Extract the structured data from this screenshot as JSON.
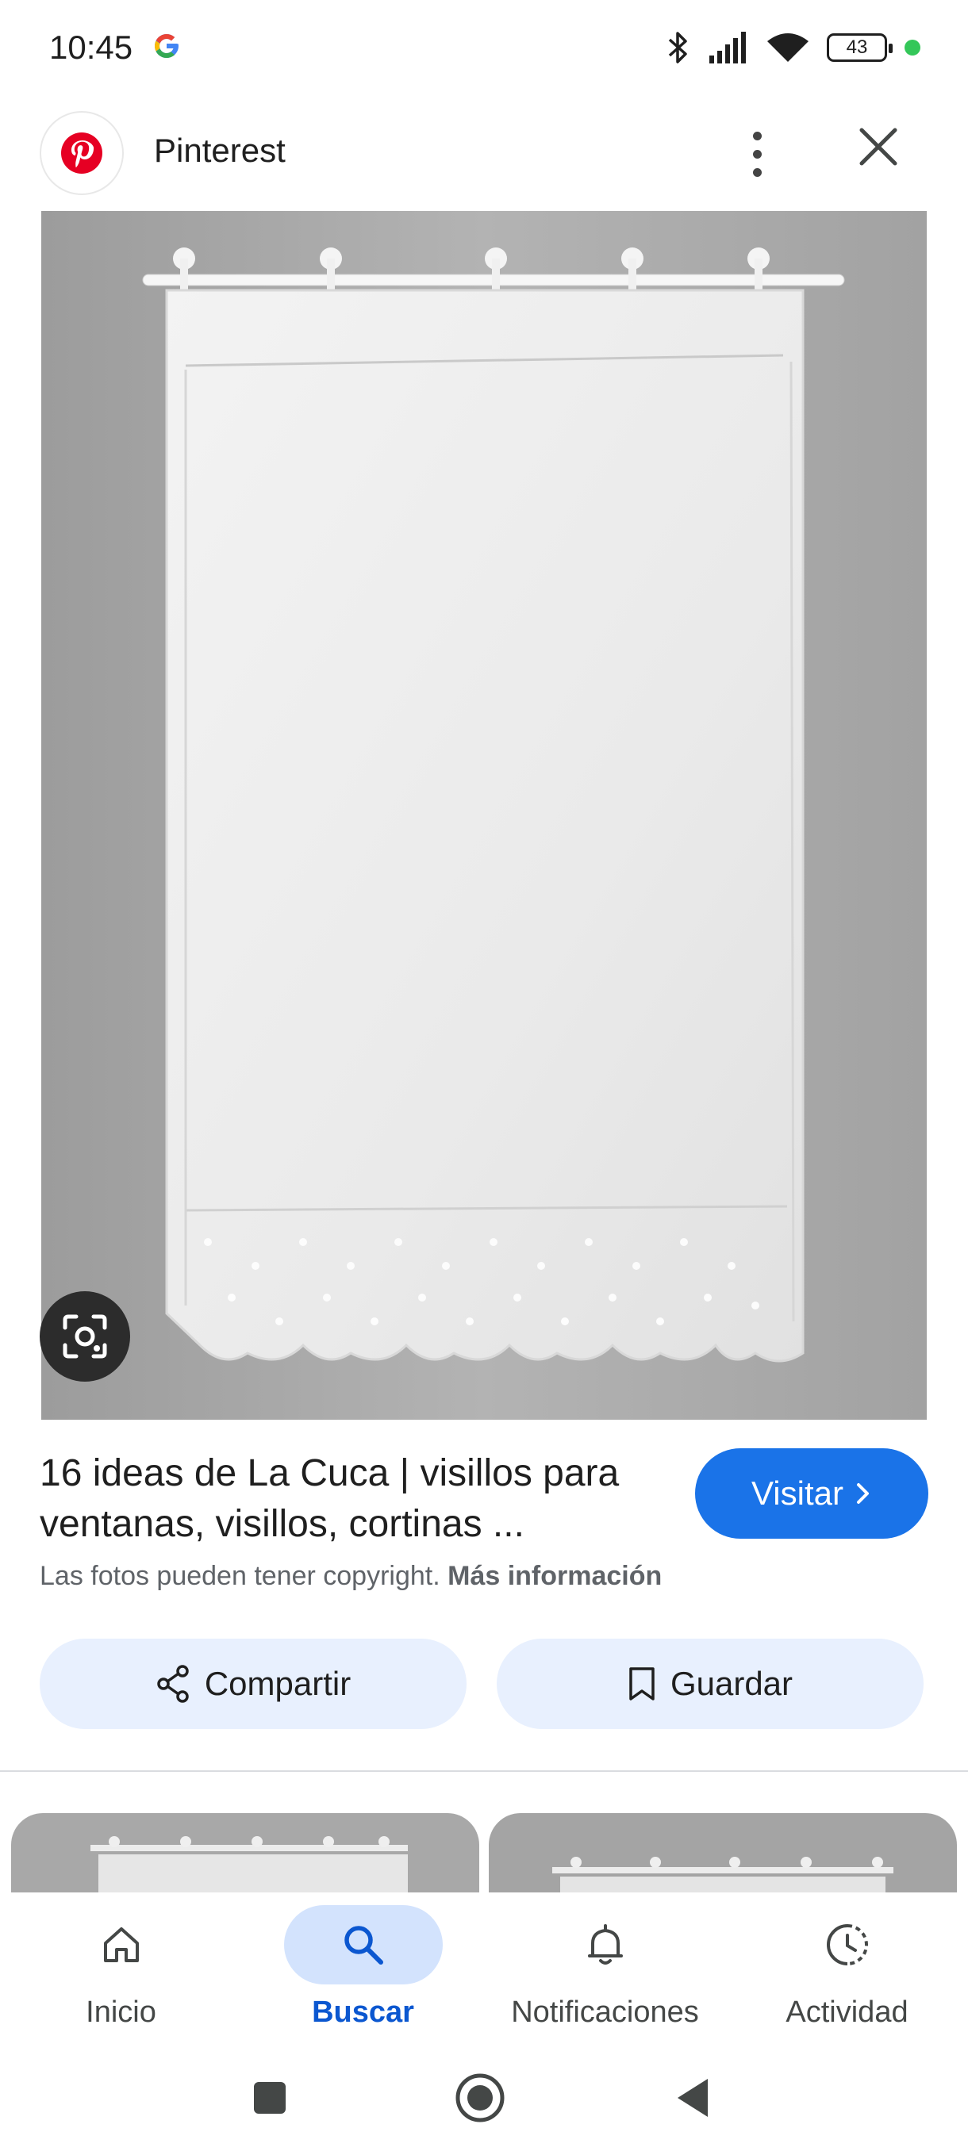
{
  "status_bar": {
    "time": "10:45",
    "battery": "43",
    "icons": [
      "google-g-icon",
      "bluetooth-icon",
      "signal-icon",
      "wifi-icon",
      "battery-icon",
      "privacy-dot"
    ]
  },
  "header": {
    "source_name": "Pinterest",
    "source_icon": "pinterest-logo",
    "menu_icon": "more-vert-icon",
    "close_icon": "close-icon"
  },
  "result": {
    "title": "16 ideas de La Cuca | visillos para ventanas, visillos, cortinas ...",
    "visit_label": "Visitar",
    "copyright_text": "Las fotos pueden tener copyright.",
    "more_info_link": "Más información"
  },
  "actions": {
    "share_label": "Compartir",
    "save_label": "Guardar"
  },
  "bottom_nav": {
    "items": [
      {
        "label": "Inicio",
        "icon": "home-icon",
        "active": false
      },
      {
        "label": "Buscar",
        "icon": "search-icon",
        "active": true
      },
      {
        "label": "Notificaciones",
        "icon": "bell-icon",
        "active": false
      },
      {
        "label": "Actividad",
        "icon": "activity-icon",
        "active": false
      }
    ]
  },
  "system_nav": {
    "icons": [
      "recents-square-icon",
      "home-circle-icon",
      "back-triangle-icon"
    ]
  },
  "colors": {
    "accent": "#1a73e8",
    "chip_bg": "#e8f0fe",
    "nav_active_bg": "#d3e3fd",
    "nav_active_text": "#0b57d0"
  }
}
